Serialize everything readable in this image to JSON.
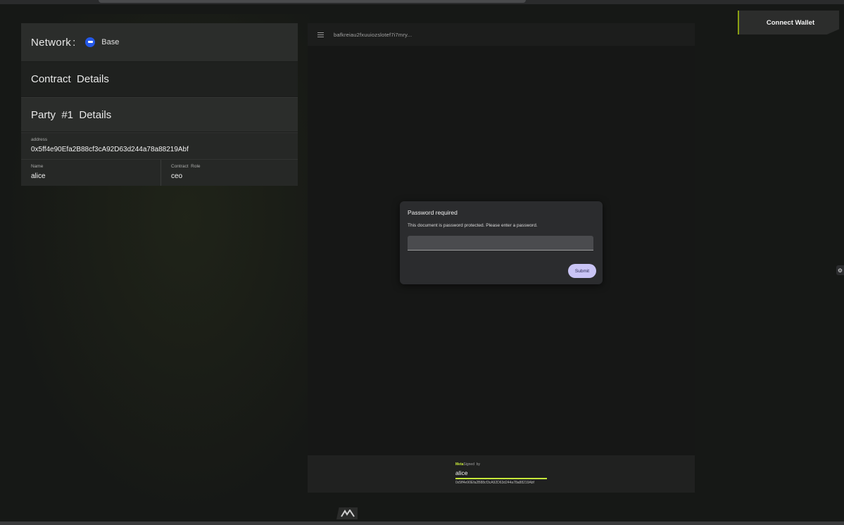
{
  "header": {
    "connect_wallet_label": "Connect Wallet"
  },
  "network": {
    "label": "Network",
    "colon": ":",
    "chain_name": "Base",
    "chain_color": "#2458e8"
  },
  "contract": {
    "title": "Contract  Details"
  },
  "party": {
    "title": "Party  #1  Details",
    "address_label": "address",
    "address_value": "0x5ff4e90Efa2B88cf3cA92D63d244a78a88219Abf",
    "name_label": "Name",
    "name_value": "alice",
    "role_label": "Contract  Role",
    "role_value": "ceo"
  },
  "viewer": {
    "filename": "bafkreiau2fxuuiozslotef7i7mry..."
  },
  "modal": {
    "title": "Password required",
    "message": "This document is password protected. Please enter a password.",
    "input_value": "",
    "submit_label": "Submit"
  },
  "signature": {
    "brand": "Meta",
    "signed_by": "Signed  by",
    "name": "alice",
    "address": "0x5ff4e90Efa2B88cf3cA92D63d244a78a88219Abf",
    "accent_color": "#c6e83a"
  },
  "icons": {
    "menu": "menu-icon",
    "chain": "base-chain-icon",
    "side_toggle": "accessibility-toggle-icon",
    "logo": "metasigned-logo-icon"
  }
}
